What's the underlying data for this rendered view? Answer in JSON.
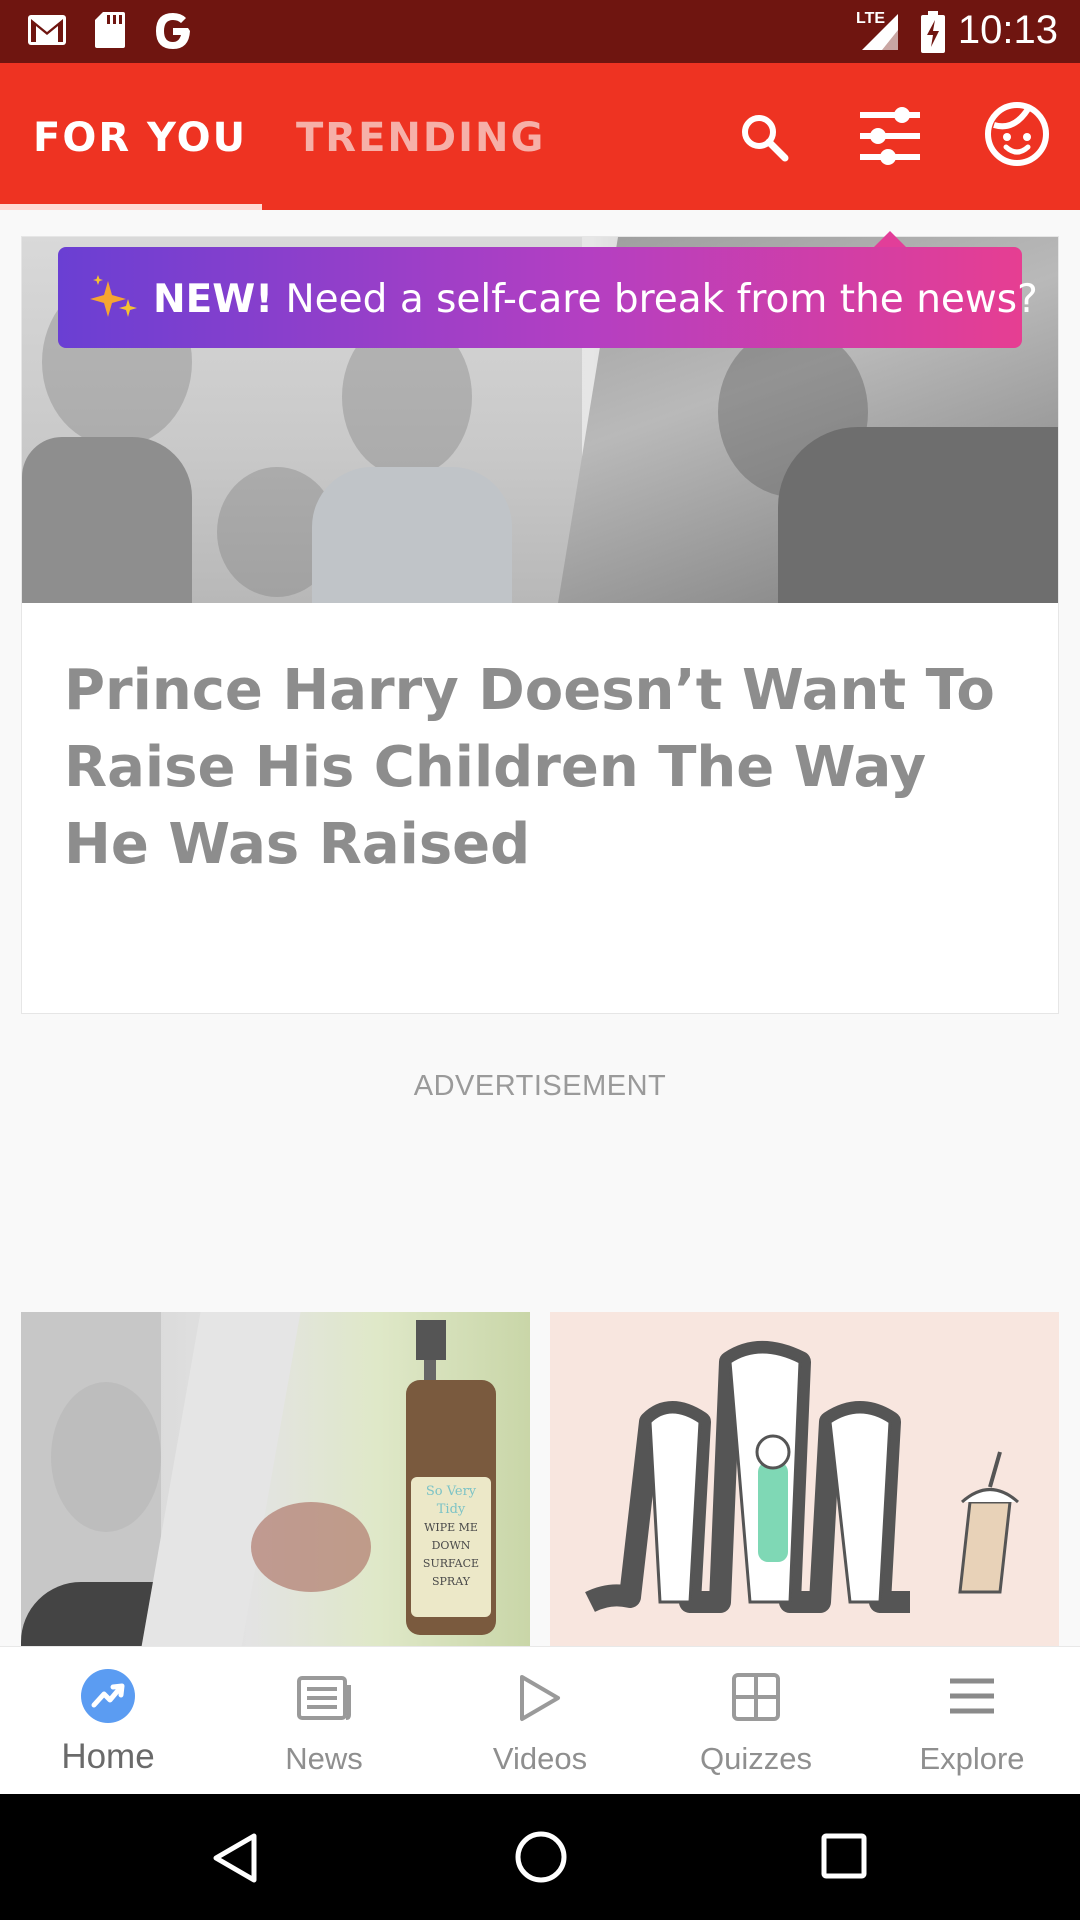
{
  "status_bar": {
    "time": "10:13",
    "network": "LTE",
    "icons": [
      "gmail-icon",
      "sd-card-icon",
      "google-icon",
      "signal-icon",
      "battery-charging-icon"
    ]
  },
  "top_bar": {
    "tabs": [
      {
        "label": "FOR YOU",
        "active": true
      },
      {
        "label": "TRENDING",
        "active": false
      }
    ],
    "actions": [
      "search-icon",
      "filter-sliders-icon",
      "profile-face-icon"
    ],
    "colors": {
      "bar": "#ee3322",
      "status": "#6f1510"
    }
  },
  "banner": {
    "new_label": "NEW!",
    "text": "Need a self-care break from the news?",
    "icon": "sparkles-icon"
  },
  "feed": {
    "featured": {
      "title": "Prince Harry Doesn’t Want To Raise His Children The Way He Was Raised"
    },
    "ad_label": "ADVERTISEMENT",
    "thumbnails": [
      {
        "text_lines": [
          "So Very Tidy",
          "WIPE ME DOWN",
          "SURFACE SPRAY"
        ]
      },
      {
        "text_lines": []
      }
    ]
  },
  "bottom_nav": {
    "items": [
      {
        "label": "Home",
        "icon": "trending-icon",
        "active": true
      },
      {
        "label": "News",
        "icon": "newspaper-icon",
        "active": false
      },
      {
        "label": "Videos",
        "icon": "play-icon",
        "active": false
      },
      {
        "label": "Quizzes",
        "icon": "grid-icon",
        "active": false
      },
      {
        "label": "Explore",
        "icon": "menu-icon",
        "active": false
      }
    ]
  },
  "system_nav": [
    "back-icon",
    "home-circle-icon",
    "recents-icon"
  ]
}
